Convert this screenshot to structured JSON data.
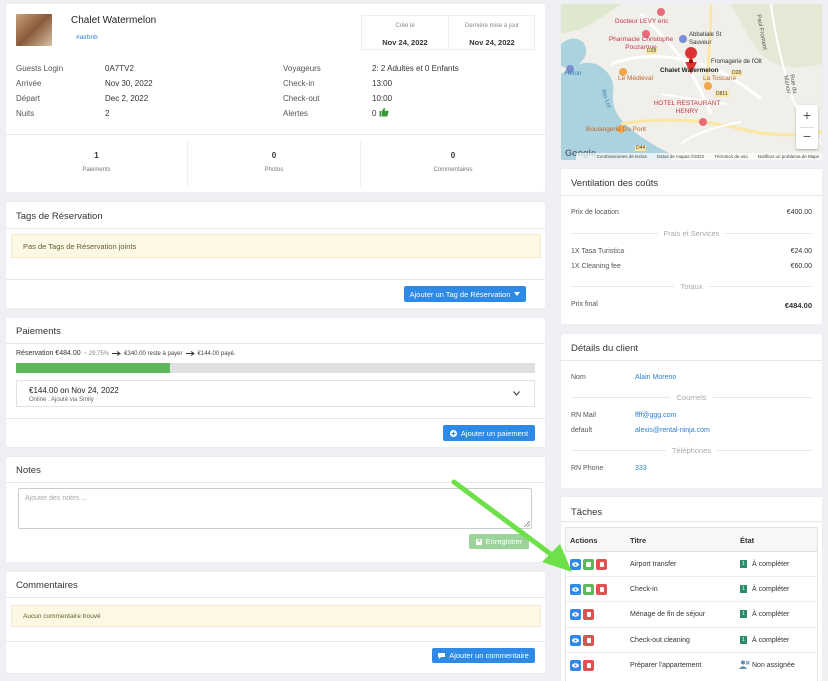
{
  "header": {
    "property_name": "Chalet Watermelon",
    "source_tag": "#airbnb",
    "created_label": "Créé le",
    "created_value": "Nov 24, 2022",
    "updated_label": "Dernière mise à jour",
    "updated_value": "Nov 24, 2022"
  },
  "details": {
    "left": [
      {
        "label": "Guests Login",
        "value": "0A7TV2"
      },
      {
        "label": "Arrivée",
        "value": "Nov 30, 2022"
      },
      {
        "label": "Départ",
        "value": "Dec 2, 2022"
      },
      {
        "label": "Nuits",
        "value": "2"
      }
    ],
    "right": [
      {
        "label": "Voyageurs",
        "value": "2: 2 Adultes et 0 Enfants"
      },
      {
        "label": "Check-in",
        "value": "13:00"
      },
      {
        "label": "Check-out",
        "value": "10:00"
      },
      {
        "label": "Alertes",
        "value": "0"
      }
    ]
  },
  "stats": [
    {
      "count": "1",
      "label": "Paiements"
    },
    {
      "count": "0",
      "label": "Photos"
    },
    {
      "count": "0",
      "label": "Commentaires"
    }
  ],
  "tags": {
    "title": "Tags de Réservation",
    "empty": "Pas de Tags de Réservation joints",
    "add_button": "Ajouter un Tag de Réservation"
  },
  "payments": {
    "title": "Paiements",
    "summary_main": "Réservation €484.00",
    "summary_pct": "~ 29.75%",
    "summary_remaining": "€340.00 reste à payer",
    "summary_paid": "€144.00 payé.",
    "progress": 0.2975,
    "item_title": "€144.00 on Nov 24, 2022",
    "item_sub": "Online . Ajouté via Smily",
    "add_button": "Ajouter un paiement"
  },
  "notes": {
    "title": "Notes",
    "placeholder": "Ajouter des notes ...",
    "save_button": "Enregistrer"
  },
  "comments": {
    "title": "Commentaires",
    "empty": "Aucun commentaire trouvé",
    "add_button": "Ajouter un commentaire"
  },
  "map": {
    "labels": [
      "Docteur LEVY eric",
      "Pharmacie Christophe Pouzargue",
      "Abbatiale St Sauveur",
      "Le Médiéval",
      "Chalet Watermelon",
      "La Toscane",
      "HOTEL RESTAURANT HENRY",
      "Boulangerie Du Pont",
      "Rio Lot",
      "Héron",
      "Paul Froment",
      "Rue du Manoir",
      "Fromagerie de l'Olt",
      "D44",
      "D811",
      "D28",
      "D28"
    ],
    "footer": [
      "Combinaciones de teclas",
      "Datos de mapas ©2022",
      "Términos de uso",
      "Notificar un problema de Maps"
    ],
    "zoom_in": "+",
    "zoom_out": "−",
    "google": "Google"
  },
  "costs": {
    "title": "Ventilation des coûts",
    "rental_label": "Prix de location",
    "rental_value": "€400.00",
    "fees_header": "Frais et Services",
    "fees": [
      {
        "label": "1X Tasa Turistica",
        "value": "€24.00"
      },
      {
        "label": "1X Cleaning fee",
        "value": "€60.00"
      }
    ],
    "totals_header": "Totaux",
    "final_label": "Prix final",
    "final_value": "€484.00"
  },
  "client": {
    "title": "Détails du client",
    "name_label": "Nom",
    "name_value": "Alain Moreno",
    "emails_header": "Courriels",
    "emails": [
      {
        "label": "RN Mail",
        "value": "ffff@ggg.com"
      },
      {
        "label": "default",
        "value": "alexis@rental-ninja.com"
      }
    ],
    "phones_header": "Téléphones",
    "phones": [
      {
        "label": "RN Phone",
        "value": "333"
      }
    ]
  },
  "tasks": {
    "title": "Tâches",
    "columns": [
      "Actions",
      "Titre",
      "État"
    ],
    "rows": [
      {
        "title": "Airport transfer",
        "state": "À compléter"
      },
      {
        "title": "Check-in",
        "state": "À compléter"
      },
      {
        "title": "Ménage de fin de séjour",
        "state": "À compléter"
      },
      {
        "title": "Check-out cleaning",
        "state": "À compléter"
      },
      {
        "title": "Préparer l'appartement",
        "state": "Non assignée"
      }
    ]
  },
  "colors": {
    "accent": "#2f89e6",
    "progress": "#5cb85c",
    "danger": "#e05252",
    "success": "#5cb85c",
    "arrow": "#6ee04a"
  }
}
